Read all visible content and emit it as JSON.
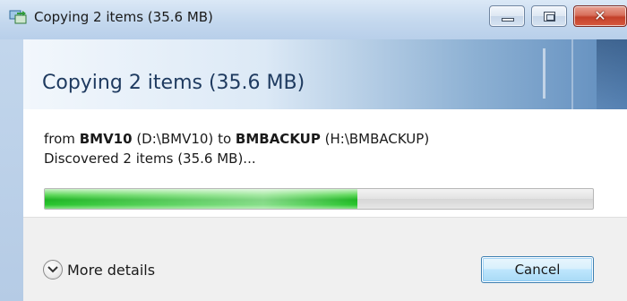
{
  "window": {
    "title": "Copying 2 items (35.6 MB)",
    "icon": "file-copy-icon"
  },
  "header": {
    "title": "Copying 2 items (35.6 MB)"
  },
  "copy": {
    "from_word": "from",
    "source_name": "BMV10",
    "source_path": "(D:\\BMV10)",
    "to_word": "to",
    "dest_name": "BMBACKUP",
    "dest_path": "(H:\\BMBACKUP)",
    "status": "Discovered 2 items (35.6 MB)..."
  },
  "progress": {
    "fraction": 0.57,
    "color": "#27c52c"
  },
  "footer": {
    "details_label": "More details",
    "details_icon": "chevron-down-circle-icon",
    "cancel_label": "Cancel"
  },
  "colors": {
    "close_button": "#c3412a",
    "header_text": "#1e3a5f"
  }
}
